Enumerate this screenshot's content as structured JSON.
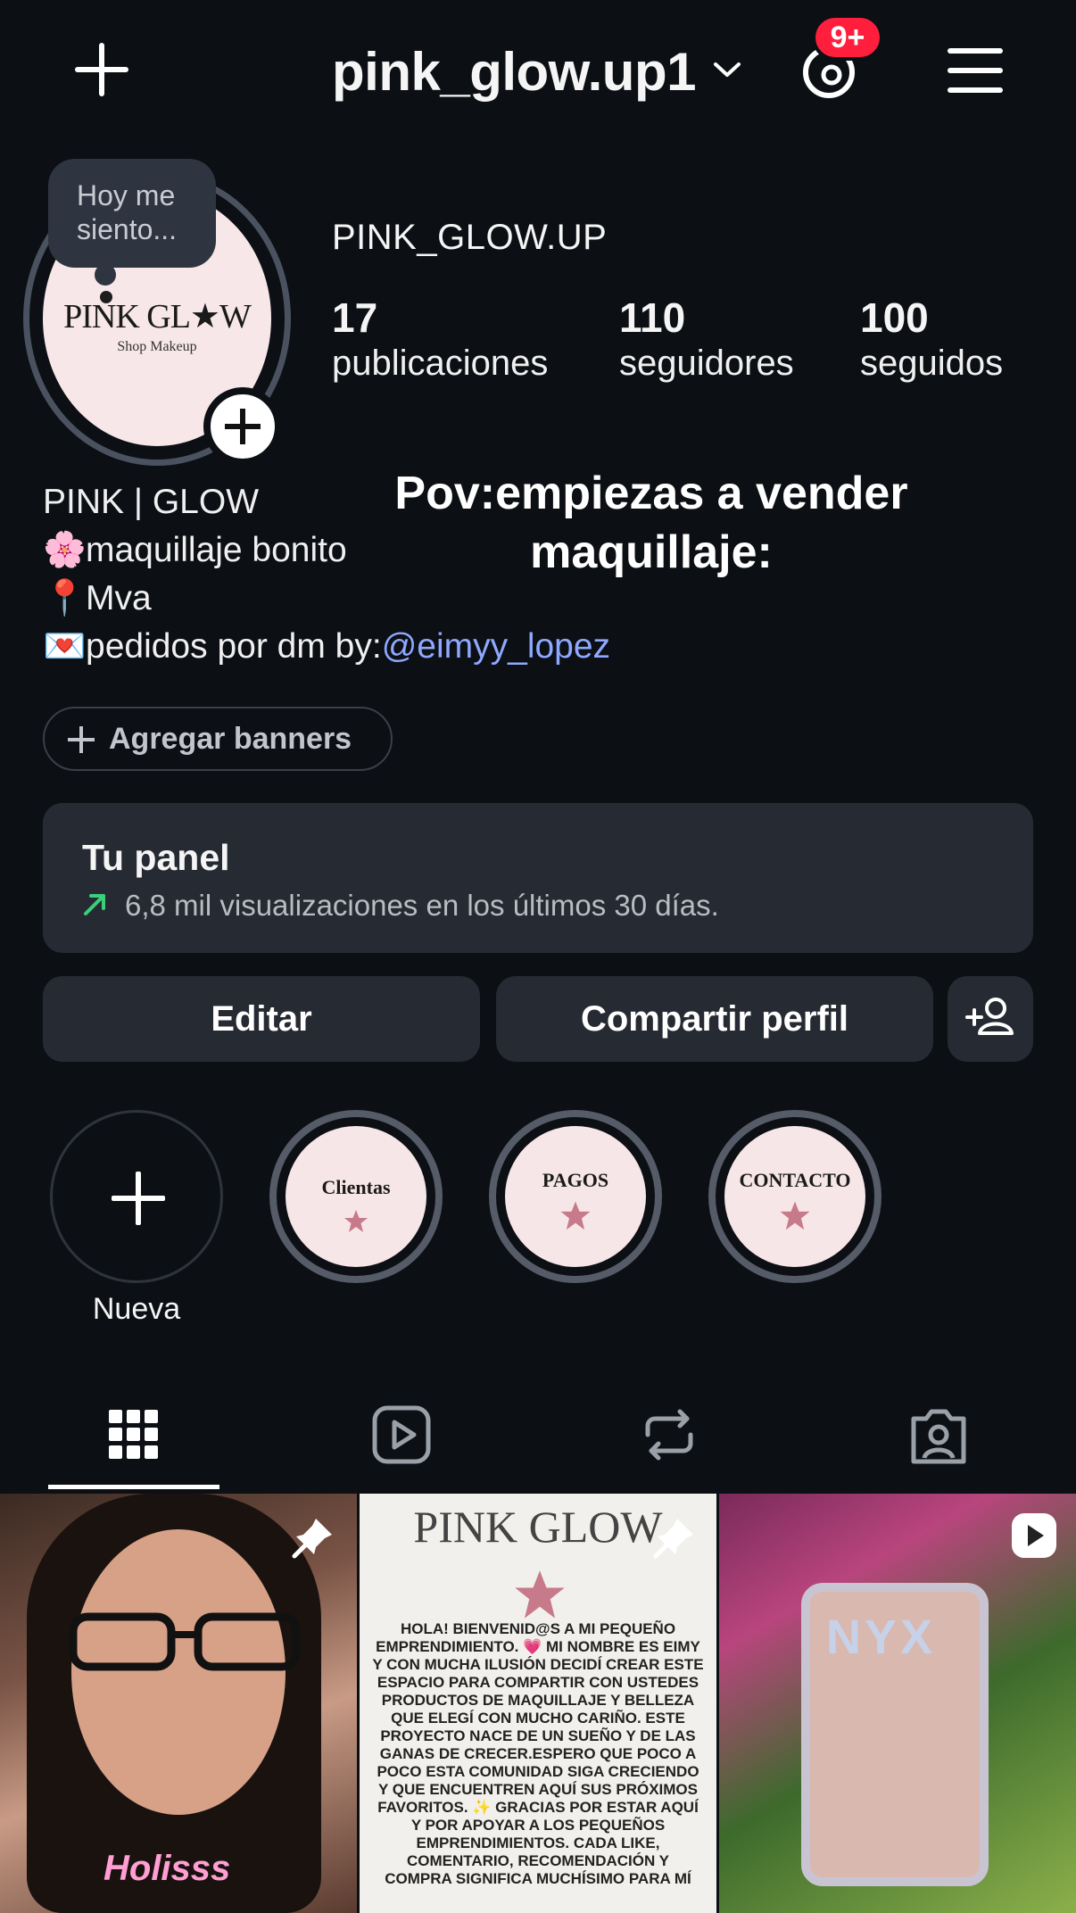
{
  "header": {
    "username": "pink_glow.up1",
    "threads_badge": "9+"
  },
  "profile": {
    "note_bubble": "Hoy me siento...",
    "logo_text": "PINK GL★W",
    "logo_sub": "Shop Makeup",
    "full_name": "PINK_GLOW.UP",
    "stats": [
      {
        "number": "17",
        "label": "publicaciones"
      },
      {
        "number": "110",
        "label": "seguidores"
      },
      {
        "number": "100",
        "label": "seguidos"
      }
    ],
    "bio": {
      "line1": "PINK | GLOW",
      "line2_emoji": "🌸",
      "line2": "maquillaje bonito",
      "line3_emoji": "📍",
      "line3": "Mva",
      "line4_emoji": "💌",
      "line4": "pedidos por dm  by:",
      "mention": "@eimyy_lopez"
    },
    "overlay_text": "Pov:empiezas a vender maquillaje:"
  },
  "banners_label": "Agregar banners",
  "panel": {
    "title": "Tu panel",
    "subtitle": "6,8 mil visualizaciones en los últimos 30 días."
  },
  "buttons": {
    "edit": "Editar",
    "share": "Compartir perfil"
  },
  "highlights": [
    {
      "label": "Nueva",
      "text": ""
    },
    {
      "label": "",
      "text": "Clientas"
    },
    {
      "label": "",
      "text": "PAGOS"
    },
    {
      "label": "",
      "text": "CONTACTO"
    }
  ],
  "tabs": [
    "grid-icon",
    "reels-icon",
    "reposts-icon",
    "tagged-icon"
  ],
  "grid": {
    "post1_caption": "Holisss",
    "post2_title": "PINK GLOW",
    "post2_body": "HOLA! BIENVENID@S A MI PEQUEÑO EMPRENDIMIENTO. 💗 MI NOMBRE ES EIMY Y CON MUCHA ILUSIÓN DECIDÍ CREAR ESTE ESPACIO PARA COMPARTIR CON USTEDES PRODUCTOS DE MAQUILLAJE Y BELLEZA QUE ELEGÍ CON MUCHO CARIÑO. ESTE PROYECTO NACE DE UN SUEÑO Y DE LAS GANAS DE CRECER.ESPERO QUE POCO A POCO ESTA COMUNIDAD SIGA CRECIENDO Y QUE ENCUENTREN AQUÍ SUS PRÓXIMOS FAVORITOS. ✨ GRACIAS POR ESTAR AQUÍ Y POR APOYAR A LOS PEQUEÑOS EMPRENDIMIENTOS. CADA LIKE, COMENTARIO, RECOMENDACIÓN Y COMPRA SIGNIFICA MUCHÍSIMO PARA MÍ",
    "post3_brand": "NYX"
  },
  "colors": {
    "background": "#0c0f14",
    "card": "#262b33",
    "badge": "#ff1f3d",
    "mention": "#8ea8ff",
    "trend_arrow": "#3ad07a"
  }
}
